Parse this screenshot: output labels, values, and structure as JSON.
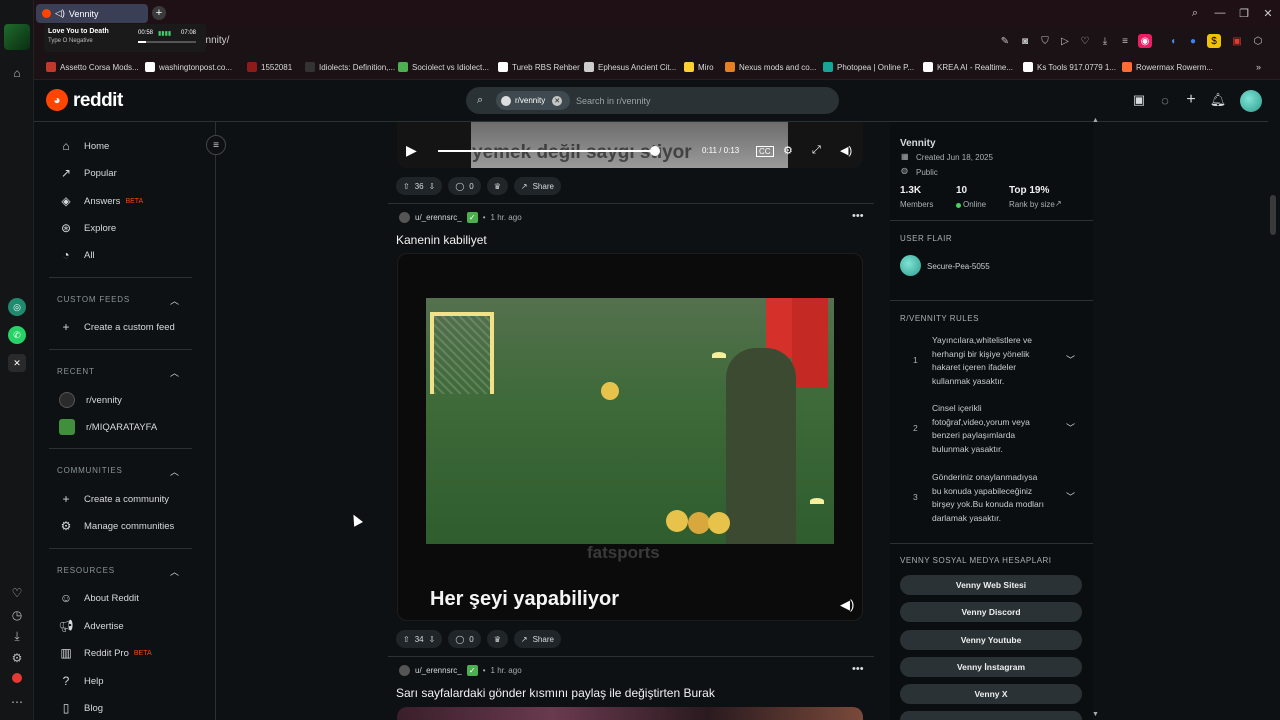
{
  "browser": {
    "tab_title": "Vennity",
    "address": "ennity/",
    "media": {
      "title": "Love You to Death",
      "artist": "Type O Negative",
      "elapsed": "00:58",
      "total": "07:08",
      "progress": 0.14
    },
    "bookmarks": [
      {
        "label": "Assetto Corsa Mods...",
        "color": "#c0392b"
      },
      {
        "label": "washingtonpost.co...",
        "color": "#ffffff"
      },
      {
        "label": "1552081",
        "color": "#8e1a1a"
      },
      {
        "label": "Idiolects: Definition,...",
        "color": "#333333"
      },
      {
        "label": "Sociolect vs Idiolect...",
        "color": "#4caf50"
      },
      {
        "label": "Tureb RBS Rehber",
        "color": "#ffffff"
      },
      {
        "label": "Ephesus Ancient Cit...",
        "color": "#cccccc"
      },
      {
        "label": "Miro",
        "color": "#ffd02f"
      },
      {
        "label": "Nexus mods and co...",
        "color": "#e67e22"
      },
      {
        "label": "Photopea | Online P...",
        "color": "#18a497"
      },
      {
        "label": "KREA AI - Realtime...",
        "color": "#ffffff"
      },
      {
        "label": "Ks Tools 917.0779 1...",
        "color": "#ffffff"
      },
      {
        "label": "Rowermax Rowerm...",
        "color": "#ff6b35"
      }
    ]
  },
  "header": {
    "logo": "reddit",
    "search_chip": "r/vennity",
    "search_placeholder": "Search in r/vennity"
  },
  "nav": {
    "home": "Home",
    "popular": "Popular",
    "answers": "Answers",
    "answers_badge": "BETA",
    "explore": "Explore",
    "all": "All",
    "custom_feeds_heading": "CUSTOM FEEDS",
    "create_custom_feed": "Create a custom feed",
    "recent_heading": "RECENT",
    "recent": [
      "r/vennity",
      "r/MIQARATAYFA"
    ],
    "communities_heading": "COMMUNITIES",
    "create_community": "Create a community",
    "manage_communities": "Manage communities",
    "resources_heading": "RESOURCES",
    "about": "About Reddit",
    "advertise": "Advertise",
    "reddit_pro": "Reddit Pro",
    "reddit_pro_badge": "BETA",
    "help": "Help",
    "blog": "Blog"
  },
  "posts": [
    {
      "video_caption": "yemek değil saygı stiyor",
      "time": "0:11 / 0:13",
      "progress": 0.85,
      "votes": "36",
      "comments": "0",
      "share": "Share"
    },
    {
      "author": "u/_erennsrc_",
      "age": "1 hr. ago",
      "title": "Kanenin kabiliyet",
      "video_watermark": "fatsports",
      "video_caption": "Her şeyi yapabiliyor",
      "votes": "34",
      "comments": "0",
      "share": "Share"
    },
    {
      "author": "u/_erennsrc_",
      "age": "1 hr. ago",
      "title": "Sarı sayfalardaki gönder kısmını paylaş ile değiştirten Burak"
    }
  ],
  "sidebar": {
    "name": "Vennity",
    "created": "Created Jun 18, 2025",
    "visibility": "Public",
    "members_value": "1.3K",
    "members_label": "Members",
    "online_value": "10",
    "online_label": "Online",
    "rank_value": "Top 19%",
    "rank_label": "Rank by size",
    "user_flair_heading": "USER FLAIR",
    "flair_user": "Secure-Pea-5055",
    "rules_heading": "R/VENNITY RULES",
    "rules": [
      {
        "n": "1",
        "text": "Yayıncılara,whitelistlere ve herhangi bir kişiye yönelik hakaret içeren ifadeler kullanmak yasaktır."
      },
      {
        "n": "2",
        "text": "Cinsel içerikli fotoğraf,video,yorum veya benzeri paylaşımlarda bulunmak yasaktır."
      },
      {
        "n": "3",
        "text": "Gönderiniz onaylanmadıysa bu konuda yapabileceğiniz birşey yok.Bu konuda modları darlamak yasaktır."
      }
    ],
    "social_heading": "VENNY SOSYAL MEDYA HESAPLARI",
    "social": [
      "Venny Web Sitesi",
      "Venny Discord",
      "Venny Youtube",
      "Venny İnstagram",
      "Venny X"
    ]
  }
}
